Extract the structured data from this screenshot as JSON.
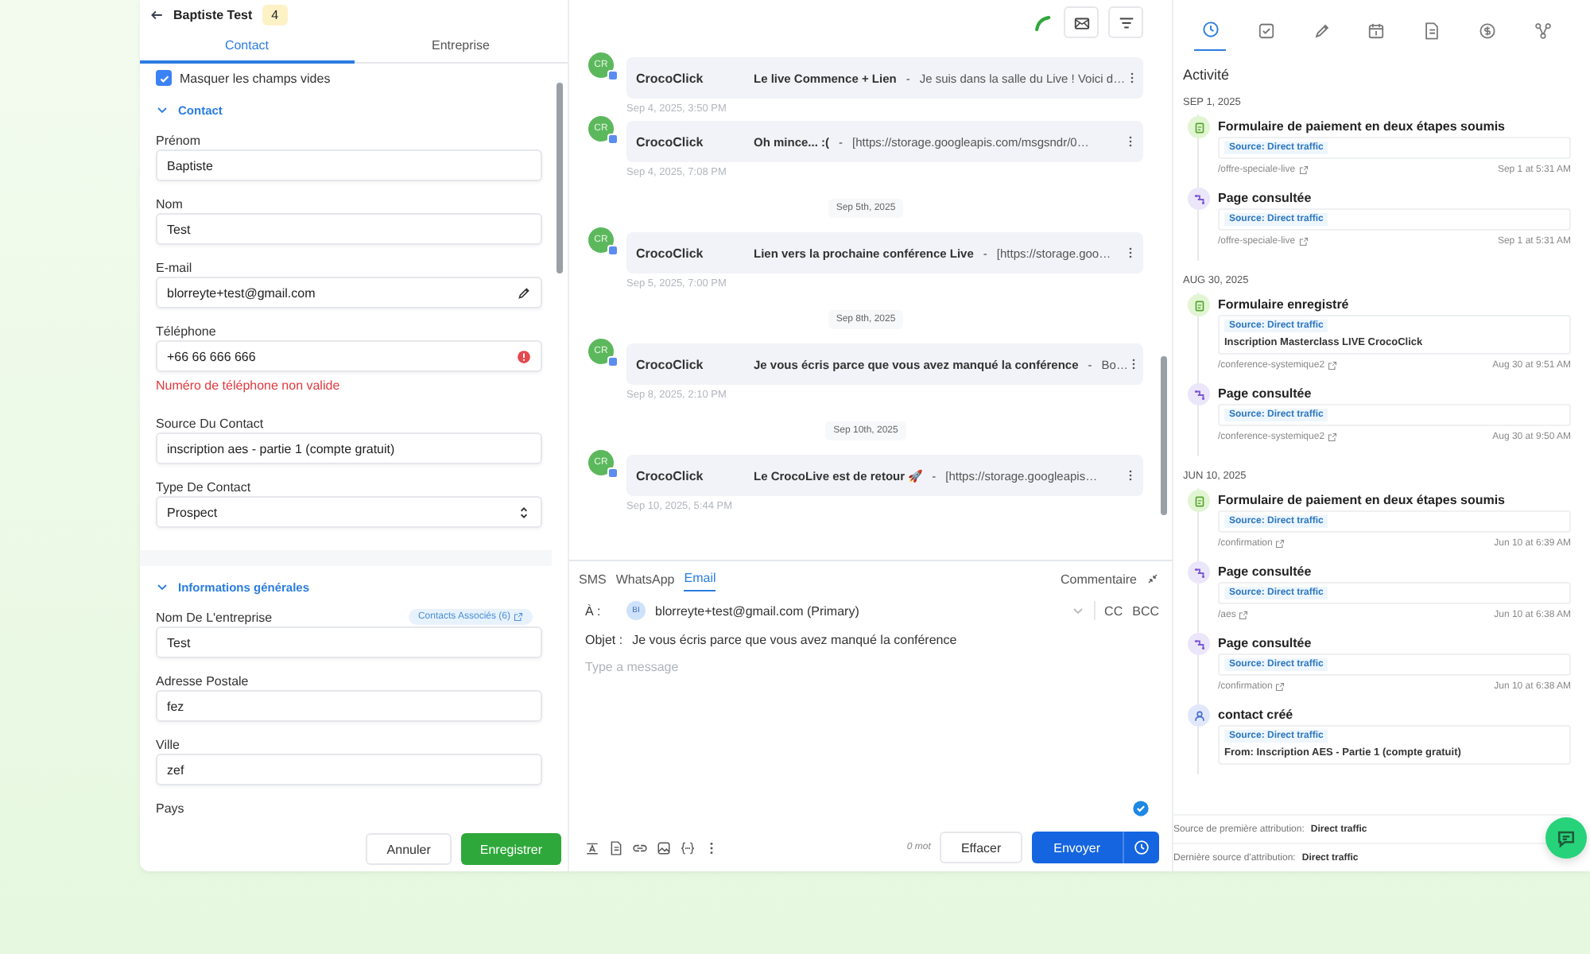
{
  "header": {
    "name": "Baptiste Test",
    "badge": "4"
  },
  "contact_tabs": [
    {
      "label": "Contact",
      "selected": true
    },
    {
      "label": "Entreprise",
      "selected": false
    }
  ],
  "hide_empty": {
    "label": "Masquer les champs vides",
    "checked": true
  },
  "sections": [
    {
      "title": "Contact",
      "expanded": true,
      "fields": [
        {
          "label": "Prénom",
          "value": "Baptiste",
          "kind": "text"
        },
        {
          "label": "Nom",
          "value": "Test",
          "kind": "text"
        },
        {
          "label": "E-mail",
          "value": "blorreyte+test@gmail.com",
          "kind": "edit"
        },
        {
          "label": "Téléphone",
          "value": "+66 66 666 666",
          "kind": "error",
          "error": "Numéro de téléphone non valide"
        },
        {
          "label": "Source Du Contact",
          "value": "inscription aes - partie 1 (compte gratuit)",
          "kind": "text"
        },
        {
          "label": "Type De Contact",
          "value": "Prospect",
          "kind": "select"
        }
      ]
    },
    {
      "title": "Informations générales",
      "expanded": true,
      "fields": [
        {
          "label": "Nom De L'entreprise",
          "value": "Test",
          "kind": "text",
          "link": "Contacts Associés (6)"
        },
        {
          "label": "Adresse Postale",
          "value": "fez",
          "kind": "text"
        },
        {
          "label": "Ville",
          "value": "zef",
          "kind": "text"
        },
        {
          "label": "Pays",
          "kind": "label"
        }
      ]
    }
  ],
  "form_buttons": [
    {
      "label": "Annuler",
      "kind": "secondary"
    },
    {
      "label": "Enregistrer",
      "kind": "primary"
    }
  ],
  "conversation": [
    {
      "kind": "message",
      "avatar": "CR",
      "sender": "CrocoClick",
      "subject": "Le live Commence + Lien",
      "separator": "-",
      "preview": "Je suis dans la salle du Live ! Voici d…",
      "time": "Sep 4, 2025, 3:50 PM"
    },
    {
      "kind": "message",
      "avatar": "CR",
      "sender": "CrocoClick",
      "subject": "Oh mince... :(",
      "separator": "-",
      "preview": "[https://storage.googleapis.com/msgsndr/0…",
      "time": "Sep 4, 2025, 7:08 PM"
    },
    {
      "kind": "date",
      "label": "Sep 5th, 2025"
    },
    {
      "kind": "message",
      "avatar": "CR",
      "sender": "CrocoClick",
      "subject": "Lien vers la prochaine conférence Live",
      "separator": "-",
      "preview": "[https://storage.goo…",
      "time": "Sep 5, 2025, 7:00 PM"
    },
    {
      "kind": "date",
      "label": "Sep 8th, 2025"
    },
    {
      "kind": "message",
      "avatar": "CR",
      "sender": "CrocoClick",
      "subject": "Je vous écris parce que vous avez manqué la conférence",
      "separator": "-",
      "preview": "Bo…",
      "time": "Sep 8, 2025, 2:10 PM"
    },
    {
      "kind": "date",
      "label": "Sep 10th, 2025"
    },
    {
      "kind": "message",
      "avatar": "CR",
      "sender": "CrocoClick",
      "subject": "Le CrocoLive est de retour 🚀",
      "separator": "-",
      "preview": "[https://storage.googleapis…",
      "time": "Sep 10, 2025, 5:44 PM"
    }
  ],
  "composer": {
    "channel_tabs": [
      {
        "label": "SMS",
        "selected": false
      },
      {
        "label": "WhatsApp",
        "selected": false
      },
      {
        "label": "Email",
        "selected": true
      }
    ],
    "comment": "Commentaire",
    "to_label": "À :",
    "to_avatar": "BI",
    "to_value": "blorreyte+test@gmail.com (Primary)",
    "cc": "CC",
    "bcc": "BCC",
    "subject_label": "Objet :",
    "subject_value": "Je vous écris parce que vous avez manqué la conférence",
    "placeholder": "Type a message",
    "word_count": "0 mot",
    "clear": "Effacer",
    "send": "Envoyer"
  },
  "activity_tabs": [
    {
      "selected": true
    },
    {
      "selected": false
    },
    {
      "selected": false
    },
    {
      "selected": false
    },
    {
      "selected": false
    },
    {
      "selected": false
    },
    {
      "selected": false
    }
  ],
  "activity": {
    "title": "Activité",
    "groups": [
      {
        "date": "SEP 1, 2025",
        "events": [
          {
            "kind": "form",
            "title": "Formulaire de paiement en deux étapes soumis",
            "source": "Source: Direct traffic",
            "link": "/offre-speciale-live",
            "time": "Sep 1 at 5:31 AM"
          },
          {
            "kind": "page",
            "title": "Page consultée",
            "source": "Source: Direct traffic",
            "link": "/offre-speciale-live",
            "time": "Sep 1 at 5:31 AM"
          }
        ]
      },
      {
        "date": "AUG 30, 2025",
        "events": [
          {
            "kind": "form",
            "title": "Formulaire enregistré",
            "source": "Source: Direct traffic",
            "detail": "Inscription Masterclass LIVE CrocoClick",
            "link": "/conference-systemique2",
            "time": "Aug 30 at 9:51 AM"
          },
          {
            "kind": "page",
            "title": "Page consultée",
            "source": "Source: Direct traffic",
            "link": "/conference-systemique2",
            "time": "Aug 30 at 9:50 AM"
          }
        ]
      },
      {
        "date": "JUN 10, 2025",
        "events": [
          {
            "kind": "form",
            "title": "Formulaire de paiement en deux étapes soumis",
            "source": "Source: Direct traffic",
            "link": "/confirmation",
            "time": "Jun 10 at 6:39 AM"
          },
          {
            "kind": "page",
            "title": "Page consultée",
            "source": "Source: Direct traffic",
            "link": "/aes",
            "time": "Jun 10 at 6:38 AM"
          },
          {
            "kind": "page",
            "title": "Page consultée",
            "source": "Source: Direct traffic",
            "link": "/confirmation",
            "time": "Jun 10 at 6:38 AM"
          },
          {
            "kind": "contact",
            "title": "contact créé",
            "source": "Source: Direct traffic",
            "detail": "From: Inscription AES - Partie 1 (compte gratuit)"
          }
        ]
      }
    ],
    "attribution": [
      {
        "label": "Source de première attribution:",
        "value": "Direct traffic"
      },
      {
        "label": "Dernière source d'attribution:",
        "value": "Direct traffic"
      }
    ]
  }
}
